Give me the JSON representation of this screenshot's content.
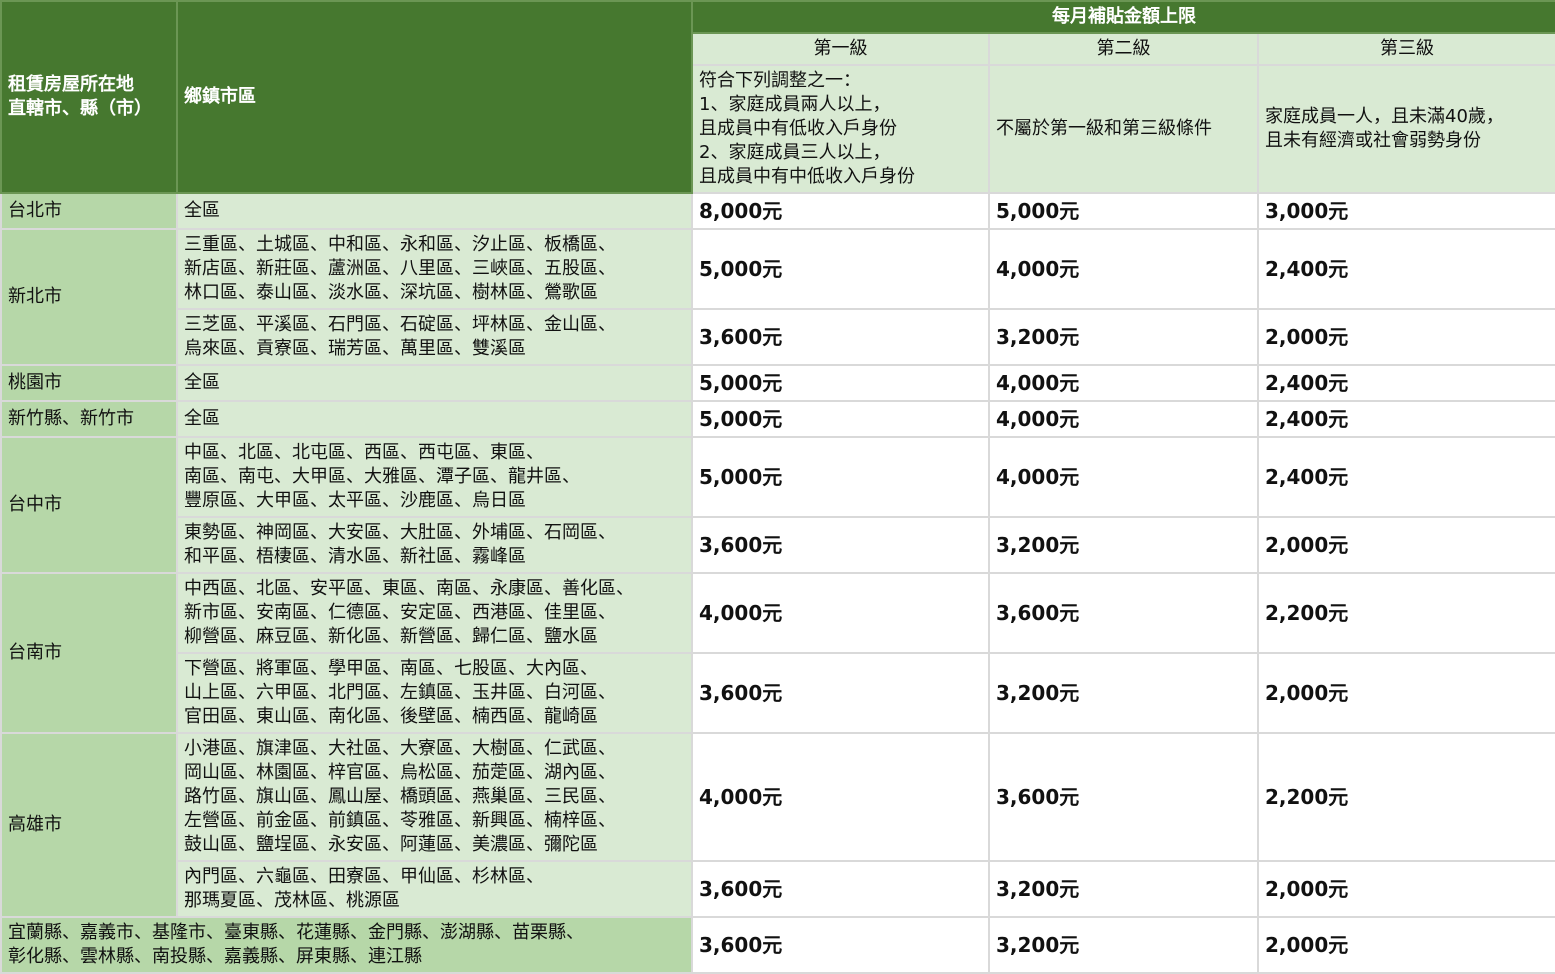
{
  "header": {
    "col_location": "租賃房屋所在地\n直轄市、縣（市）",
    "col_district": "鄉鎮市區",
    "group_title": "每月補貼金額上限",
    "levels": [
      {
        "name": "第一級",
        "desc": "符合下列調整之一：\n1、家庭成員兩人以上，\n且成員中有低收入戶身份\n2、家庭成員三人以上，\n且成員中有中低收入戶身份"
      },
      {
        "name": "第二級",
        "desc": "不屬於第一級和第三級條件"
      },
      {
        "name": "第三級",
        "desc": "家庭成員一人，且未滿40歲，\n且未有經濟或社會弱勢身份"
      }
    ]
  },
  "rows": [
    {
      "city": "台北市",
      "district": "全區",
      "l1": "8,000元",
      "l2": "5,000元",
      "l3": "3,000元"
    },
    {
      "city": "新北市",
      "district": "三重區、土城區、中和區、永和區、汐止區、板橋區、\n新店區、新莊區、蘆洲區、八里區、三峽區、五股區、\n林口區、泰山區、淡水區、深坑區、樹林區、鶯歌區",
      "l1": "5,000元",
      "l2": "4,000元",
      "l3": "2,400元"
    },
    {
      "city": "",
      "district": "三芝區、平溪區、石門區、石碇區、坪林區、金山區、\n烏來區、貢寮區、瑞芳區、萬里區、雙溪區",
      "l1": "3,600元",
      "l2": "3,200元",
      "l3": "2,000元"
    },
    {
      "city": "桃園市",
      "district": "全區",
      "l1": "5,000元",
      "l2": "4,000元",
      "l3": "2,400元"
    },
    {
      "city": "新竹縣、新竹市",
      "district": "全區",
      "l1": "5,000元",
      "l2": "4,000元",
      "l3": "2,400元"
    },
    {
      "city": "台中市",
      "district": "中區、北區、北屯區、西區、西屯區、東區、\n南區、南屯、大甲區、大雅區、潭子區、龍井區、\n豐原區、大甲區、太平區、沙鹿區、烏日區",
      "l1": "5,000元",
      "l2": "4,000元",
      "l3": "2,400元"
    },
    {
      "city": "",
      "district": "東勢區、神岡區、大安區、大肚區、外埔區、石岡區、\n和平區、梧棲區、清水區、新社區、霧峰區",
      "l1": "3,600元",
      "l2": "3,200元",
      "l3": "2,000元"
    },
    {
      "city": "台南市",
      "district": "中西區、北區、安平區、東區、南區、永康區、善化區、\n新市區、安南區、仁德區、安定區、西港區、佳里區、\n柳營區、麻豆區、新化區、新營區、歸仁區、鹽水區",
      "l1": "4,000元",
      "l2": "3,600元",
      "l3": "2,200元"
    },
    {
      "city": "",
      "district": "下營區、將軍區、學甲區、南區、七股區、大內區、\n山上區、六甲區、北門區、左鎮區、玉井區、白河區、\n官田區、東山區、南化區、後壁區、楠西區、龍崎區",
      "l1": "3,600元",
      "l2": "3,200元",
      "l3": "2,000元"
    },
    {
      "city": "高雄市",
      "district": "小港區、旗津區、大社區、大寮區、大樹區、仁武區、\n岡山區、林園區、梓官區、烏松區、茄萣區、湖內區、\n路竹區、旗山區、鳳山屋、橋頭區、燕巢區、三民區、\n左營區、前金區、前鎮區、苓雅區、新興區、楠梓區、\n鼓山區、鹽埕區、永安區、阿蓮區、美濃區、彌陀區",
      "l1": "4,000元",
      "l2": "3,600元",
      "l3": "2,200元"
    },
    {
      "city": "",
      "district": "內門區、六龜區、田寮區、甲仙區、杉林區、\n那瑪夏區、茂林區、桃源區",
      "l1": "3,600元",
      "l2": "3,200元",
      "l3": "2,000元"
    },
    {
      "city": "宜蘭縣、嘉義市、基隆市、臺東縣、花蓮縣、金門縣、澎湖縣、苗栗縣、\n彰化縣、雲林縣、南投縣、嘉義縣、屏東縣、連江縣",
      "district": "",
      "l1": "3,600元",
      "l2": "3,200元",
      "l3": "2,000元"
    }
  ]
}
